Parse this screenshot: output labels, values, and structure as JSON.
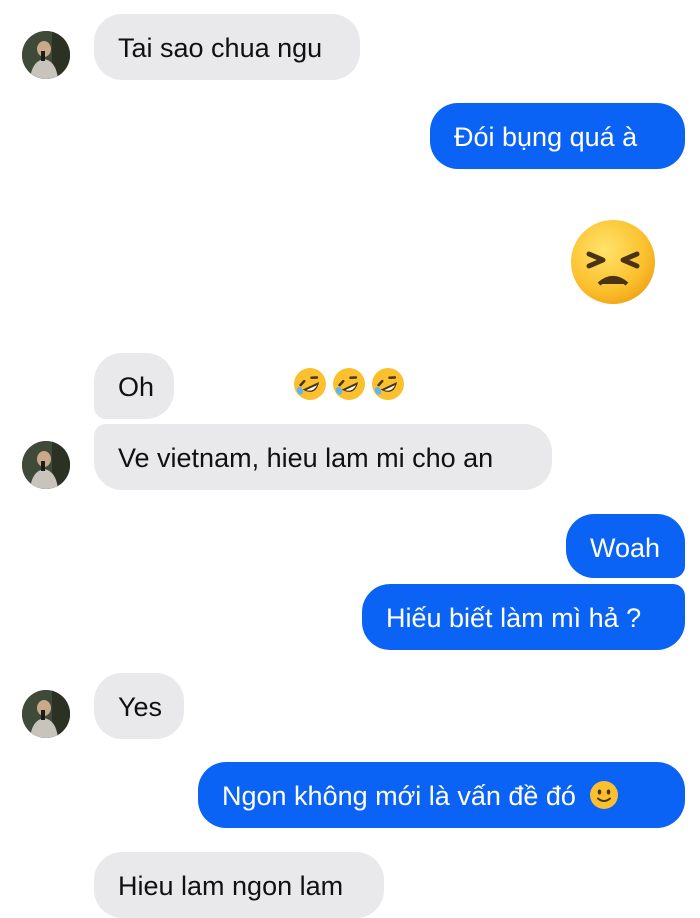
{
  "messages": [
    {
      "side": "in",
      "text": "Tai sao chua ngu"
    },
    {
      "side": "out",
      "text": "Đói bụng quá à"
    },
    {
      "side": "out",
      "emoji": "persevering-face"
    },
    {
      "side": "in",
      "text": "Oh",
      "reactions": [
        "rolling-on-floor-laughing",
        "rolling-on-floor-laughing",
        "rolling-on-floor-laughing"
      ]
    },
    {
      "side": "in",
      "text": "Ve vietnam, hieu lam mi cho an"
    },
    {
      "side": "out",
      "text": "Woah"
    },
    {
      "side": "out",
      "text": "Hiếu biết làm mì hả ?"
    },
    {
      "side": "in",
      "text": "Yes"
    },
    {
      "side": "out",
      "text": "Ngon không mới là vấn đề đó",
      "trailing_emoji": "slightly-smiling-face"
    },
    {
      "side": "in",
      "text": "Hieu lam ngon lam"
    }
  ],
  "colors": {
    "incoming_bubble": "#e9e9eb",
    "outgoing_bubble": "#0a63f5",
    "outgoing_text": "#ffffff",
    "incoming_text": "#111111"
  }
}
